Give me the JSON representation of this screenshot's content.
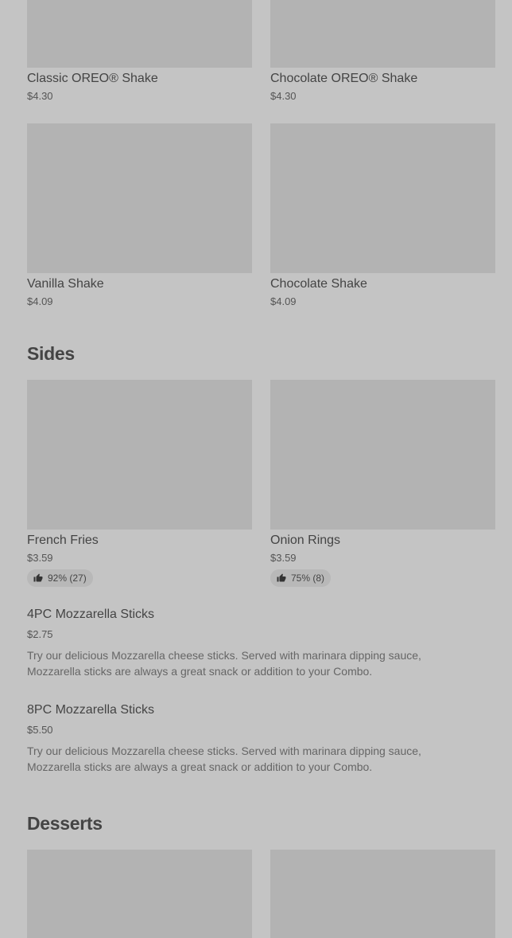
{
  "shakes": [
    {
      "name": "Classic OREO® Shake",
      "price": "$4.30"
    },
    {
      "name": "Chocolate OREO® Shake",
      "price": "$4.30"
    },
    {
      "name": "Vanilla Shake",
      "price": "$4.09"
    },
    {
      "name": "Chocolate Shake",
      "price": "$4.09"
    }
  ],
  "sides": {
    "title": "Sides",
    "cards": [
      {
        "name": "French Fries",
        "price": "$3.59",
        "rating": "92% (27)"
      },
      {
        "name": "Onion Rings",
        "price": "$3.59",
        "rating": "75% (8)"
      }
    ],
    "items": [
      {
        "name": "4PC Mozzarella Sticks",
        "price": "$2.75",
        "description": "Try our delicious Mozzarella cheese sticks. Served with marinara dipping sauce, Mozzarella sticks are always a great snack or addition to your Combo."
      },
      {
        "name": "8PC Mozzarella Sticks",
        "price": "$5.50",
        "description": "Try our delicious Mozzarella cheese sticks. Served with marinara dipping sauce, Mozzarella sticks are always a great snack or addition to your Combo."
      }
    ]
  },
  "desserts": {
    "title": "Desserts"
  }
}
